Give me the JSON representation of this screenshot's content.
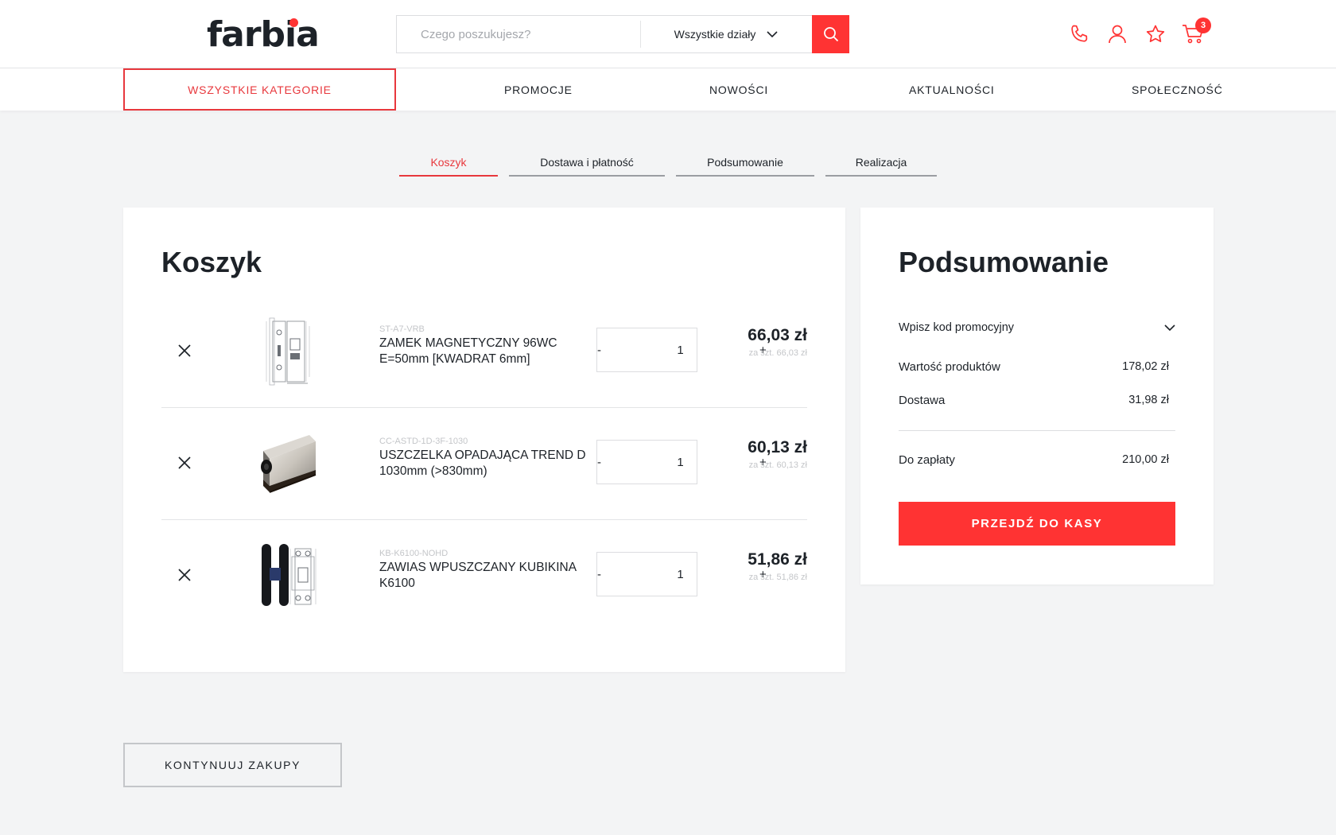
{
  "header": {
    "logo_text": "farbia",
    "search": {
      "placeholder": "Czego poszukujesz?",
      "category": "Wszystkie działy"
    },
    "icons": [
      "phone-icon",
      "user-icon",
      "star-icon",
      "cart-icon"
    ],
    "cart_count": "3"
  },
  "nav": {
    "all_categories": "WSZYSTKIE KATEGORIE",
    "items": [
      "PROMOCJE",
      "NOWOŚCI",
      "AKTUALNOŚCI",
      "SPOŁECZNOŚĆ"
    ]
  },
  "steps": [
    "Koszyk",
    "Dostawa i płatność",
    "Podsumowanie",
    "Realizacja"
  ],
  "active_step": "Koszyk",
  "cart": {
    "title": "Koszyk",
    "items": [
      {
        "sku": "ST-A7-VRB",
        "name": "ZAMEK MAGNETYCZNY 96WC E=50mm [KWADRAT 6mm]",
        "qty": "1",
        "price": "66,03 zł",
        "unit_price": "za szt. 66,03 zł",
        "minus": "-",
        "plus": "+"
      },
      {
        "sku": "CC-ASTD-1D-3F-1030",
        "name": "USZCZELKA OPADAJĄCA TREND D 1030mm (>830mm)",
        "qty": "1",
        "price": "60,13 zł",
        "unit_price": "za szt. 60,13 zł",
        "minus": "-",
        "plus": "+"
      },
      {
        "sku": "KB-K6100-NOHD",
        "name": "ZAWIAS WPUSZCZANY KUBIKINA K6100",
        "qty": "1",
        "price": "51,86 zł",
        "unit_price": "za szt. 51,86 zł",
        "minus": "-",
        "plus": "+"
      }
    ]
  },
  "summary": {
    "title": "Podsumowanie",
    "promo_label": "Wpisz kod promocyjny",
    "products_label": "Wartość produktów",
    "products_value": "178,02 zł",
    "delivery_label": "Dostawa",
    "delivery_value": "31,98 zł",
    "total_label": "Do zapłaty",
    "total_value": "210,00 zł",
    "checkout": "PRZEJDŹ DO KASY"
  },
  "continue_shopping": "KONTYNUUJ ZAKUPY",
  "colors": {
    "accent": "#ff3333",
    "text": "#1d2228",
    "background": "#f3f4f5"
  }
}
